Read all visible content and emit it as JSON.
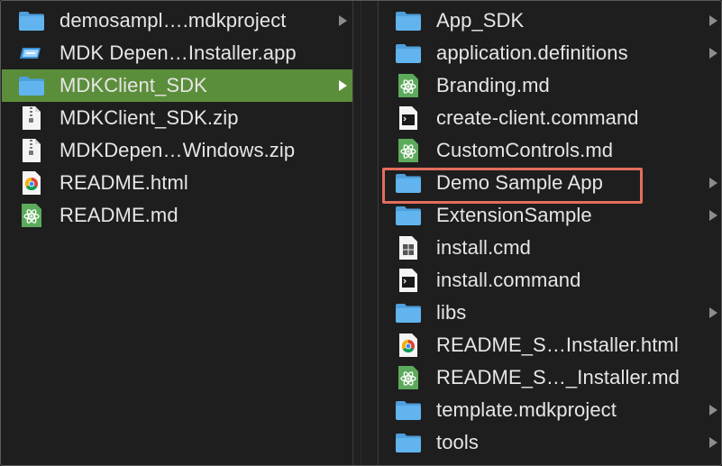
{
  "left_column": {
    "items": [
      {
        "label": "demosampl….mdkproject",
        "icon": "folder-icon",
        "has_children": true
      },
      {
        "label": "MDK Depen…Installer.app",
        "icon": "app-icon",
        "has_children": false
      },
      {
        "label": "MDKClient_SDK",
        "icon": "folder-icon",
        "has_children": true,
        "selected": true
      },
      {
        "label": "MDKClient_SDK.zip",
        "icon": "zip-file-icon",
        "has_children": false
      },
      {
        "label": "MDKDepen…Windows.zip",
        "icon": "zip-file-icon",
        "has_children": false
      },
      {
        "label": "README.html",
        "icon": "chrome-html-icon",
        "has_children": false
      },
      {
        "label": "README.md",
        "icon": "atom-markdown-icon",
        "has_children": false
      }
    ]
  },
  "right_column": {
    "items": [
      {
        "label": "App_SDK",
        "icon": "folder-icon",
        "has_children": true
      },
      {
        "label": "application.definitions",
        "icon": "folder-icon",
        "has_children": true
      },
      {
        "label": "Branding.md",
        "icon": "atom-markdown-icon",
        "has_children": false
      },
      {
        "label": "create-client.command",
        "icon": "terminal-script-icon",
        "has_children": false
      },
      {
        "label": "CustomControls.md",
        "icon": "atom-markdown-icon",
        "has_children": false
      },
      {
        "label": "Demo Sample App",
        "icon": "folder-icon",
        "has_children": true,
        "highlighted": true
      },
      {
        "label": "ExtensionSample",
        "icon": "folder-icon",
        "has_children": true
      },
      {
        "label": "install.cmd",
        "icon": "windows-cmd-icon",
        "has_children": false
      },
      {
        "label": "install.command",
        "icon": "terminal-script-icon",
        "has_children": false
      },
      {
        "label": "libs",
        "icon": "folder-icon",
        "has_children": true
      },
      {
        "label": "README_S…Installer.html",
        "icon": "chrome-html-icon",
        "has_children": false
      },
      {
        "label": "README_S…_Installer.md",
        "icon": "atom-markdown-icon",
        "has_children": false
      },
      {
        "label": "template.mdkproject",
        "icon": "folder-icon",
        "has_children": true
      },
      {
        "label": "tools",
        "icon": "folder-icon",
        "has_children": true
      }
    ]
  },
  "colors": {
    "background": "#1e1e1e",
    "selection": "#5b8e3a",
    "highlight_box": "#e36e5d",
    "folder": "#5fb0e8",
    "markdown_icon": "#5cab5c"
  }
}
